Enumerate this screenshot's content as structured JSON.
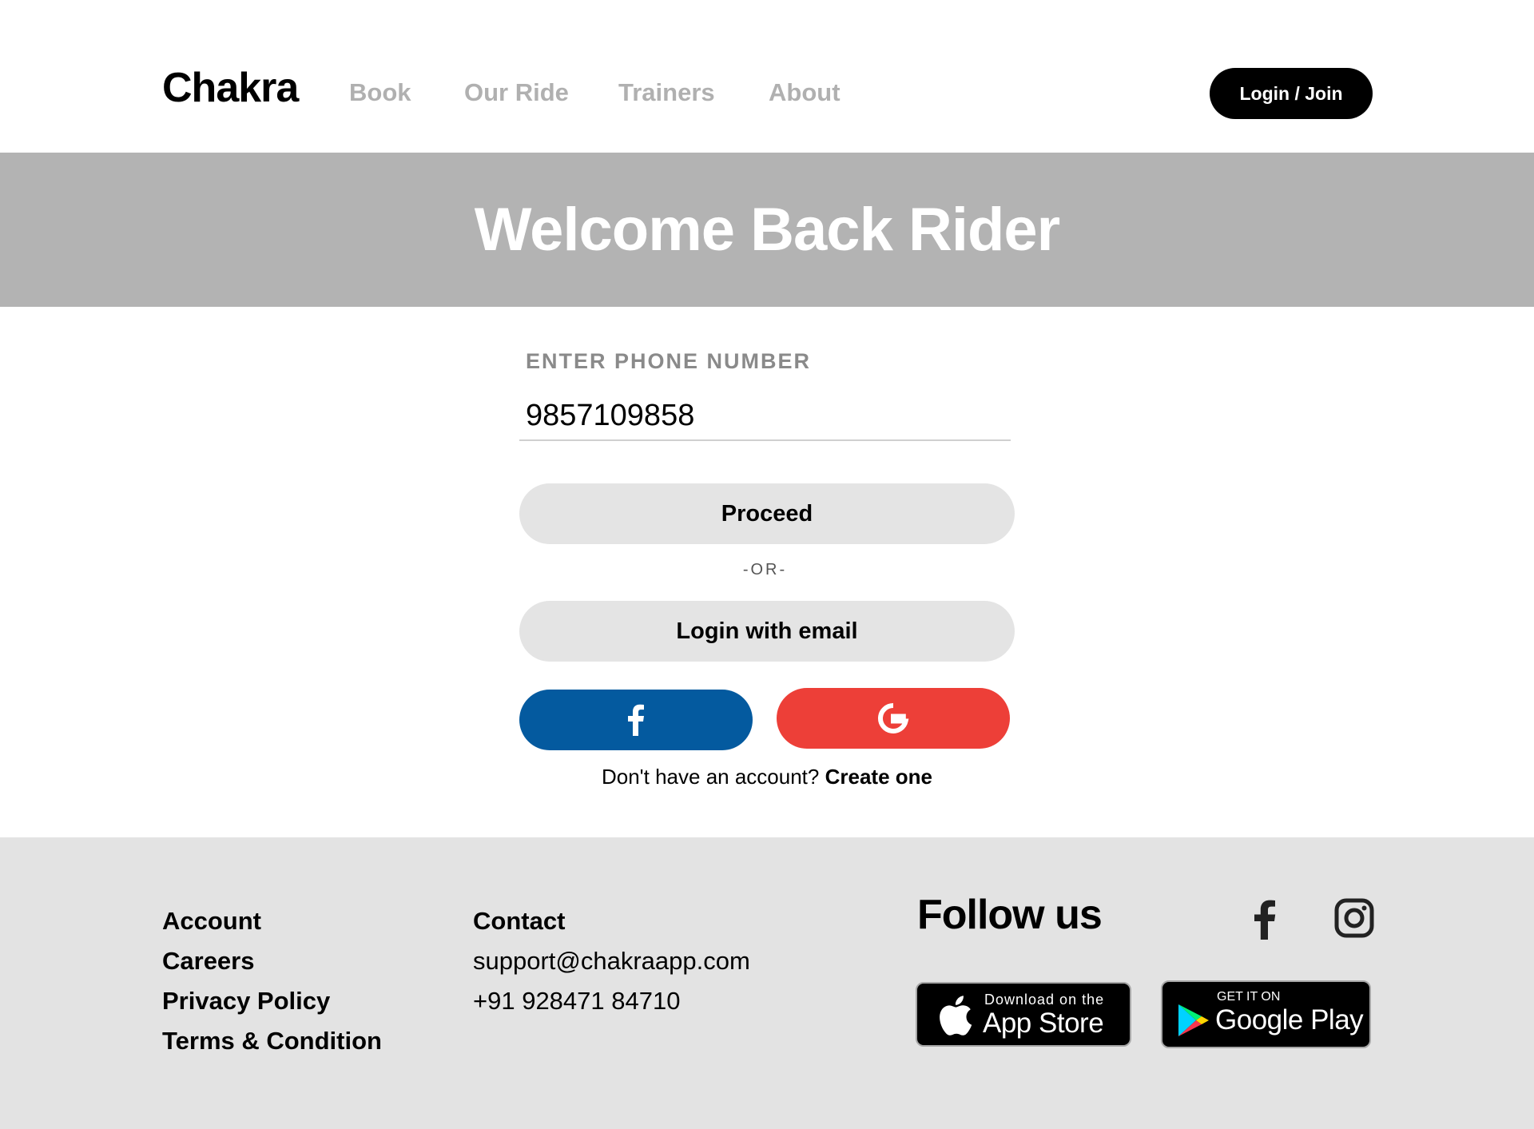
{
  "header": {
    "logo": "Chakra",
    "nav": [
      "Book",
      "Our Ride",
      "Trainers",
      "About"
    ],
    "login_label": "Login / Join"
  },
  "hero": {
    "title": "Welcome Back Rider"
  },
  "form": {
    "phone_label": "ENTER PHONE NUMBER",
    "phone_value": "9857109858",
    "proceed_label": "Proceed",
    "or_label": "-OR-",
    "email_login_label": "Login with email",
    "facebook_icon": "facebook-icon",
    "google_icon": "google-icon",
    "signup_prompt": "Don't have an account?",
    "signup_link": "Create one"
  },
  "footer": {
    "links": [
      "Account",
      "Careers",
      "Privacy Policy",
      "Terms & Condition"
    ],
    "contact_heading": "Contact",
    "email": "support@chakraapp.com",
    "phone": "+91 928471 84710",
    "follow_heading": "Follow us",
    "social_icons": [
      "facebook-icon",
      "instagram-icon"
    ],
    "app_store": {
      "small": "Download on the",
      "big": "App Store"
    },
    "google_play": {
      "small": "GET IT ON",
      "big": "Google Play"
    }
  },
  "colors": {
    "hero_bg": "#b3b3b3",
    "footer_bg": "#e3e3e3",
    "facebook": "#045a9f",
    "google": "#ed3f38",
    "button_bg": "#e4e4e4",
    "nav_text": "#b0b0b0"
  }
}
